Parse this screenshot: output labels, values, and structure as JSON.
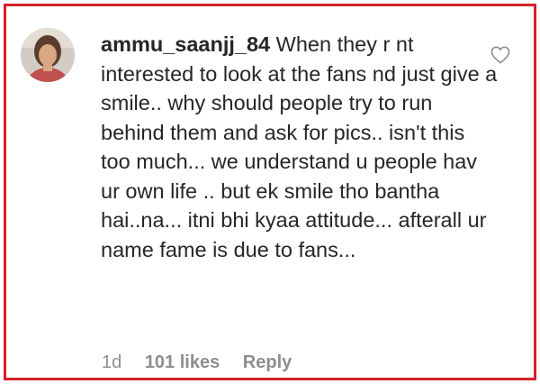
{
  "comment": {
    "username": "ammu_saanjj_84",
    "text": "When they r nt interested to look at the fans nd just give a smile.. why should people try to run behind them and ask for pics.. isn't this too much... we understand u people hav ur own life .. but ek smile tho bantha hai..na... itni bhi kyaa attitude... afterall ur name fame is due to fans..."
  },
  "meta": {
    "time": "1d",
    "likes": "101 likes",
    "reply": "Reply"
  },
  "icons": {
    "like": "heart-outline-icon",
    "avatar": "profile-photo"
  },
  "colors": {
    "border": "#d6222b",
    "text": "#262626",
    "muted": "#8e8e8e"
  }
}
